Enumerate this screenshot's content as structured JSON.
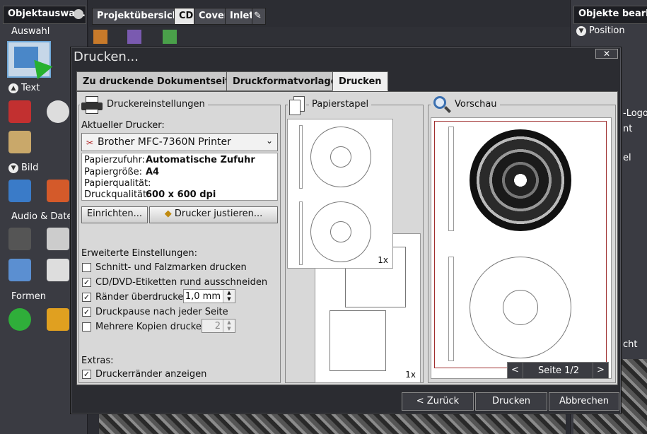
{
  "app": {
    "left_panel": {
      "title": "Objektauswa...",
      "sections": [
        "Auswahl",
        "Text",
        "Bild",
        "Audio & Datei",
        "Formen"
      ]
    },
    "tabs": [
      "Projektübersicht",
      "CD",
      "Cover",
      "Inlet"
    ],
    "right_panel": {
      "title": "Objekte bearbeit",
      "position_label": "Position",
      "partial_items": [
        "-Logo",
        "nt",
        "el",
        "cht"
      ]
    }
  },
  "dialog": {
    "title": "Drucken...",
    "close_icon": "close-icon",
    "tabs": [
      "Zu druckende Dokumentseiten",
      "Druckformatvorlagen",
      "Drucken"
    ],
    "active_tab": "Drucken",
    "printer_settings": {
      "title": "Druckereinstellungen",
      "current_printer_label": "Aktueller Drucker:",
      "printer_name": "Brother MFC-7360N Printer",
      "info": [
        {
          "label": "Papierzufuhr:",
          "value": "Automatische Zufuhr"
        },
        {
          "label": "Papiergröße:",
          "value": "A4"
        },
        {
          "label": "Papierqualität:",
          "value": ""
        },
        {
          "label": "Druckqualität:",
          "value": "600 x 600 dpi"
        }
      ],
      "setup_button": "Einrichten...",
      "calibrate_button": "Drucker justieren..."
    },
    "advanced": {
      "title": "Erweiterte Einstellungen:",
      "options": [
        {
          "label": "Schnitt- und Falzmarken drucken",
          "checked": false
        },
        {
          "label": "CD/DVD-Etiketten rund ausschneiden",
          "checked": true
        },
        {
          "label": "Ränder überdrucken",
          "checked": true,
          "value": "1,0 mm"
        },
        {
          "label": "Druckpause nach jeder Seite",
          "checked": true
        },
        {
          "label": "Mehrere Kopien drucken",
          "checked": false,
          "value": "2"
        }
      ]
    },
    "extras": {
      "title": "Extras:",
      "option": {
        "label": "Druckerränder anzeigen",
        "checked": true
      }
    },
    "paper_stack": {
      "title": "Papierstapel",
      "count1": "1x",
      "count2": "1x"
    },
    "preview": {
      "title": "Vorschau",
      "page_label": "Seite 1/2",
      "prev": "<",
      "next": ">"
    },
    "footer": {
      "back": "< Zurück",
      "print": "Drucken",
      "cancel": "Abbrechen"
    }
  }
}
